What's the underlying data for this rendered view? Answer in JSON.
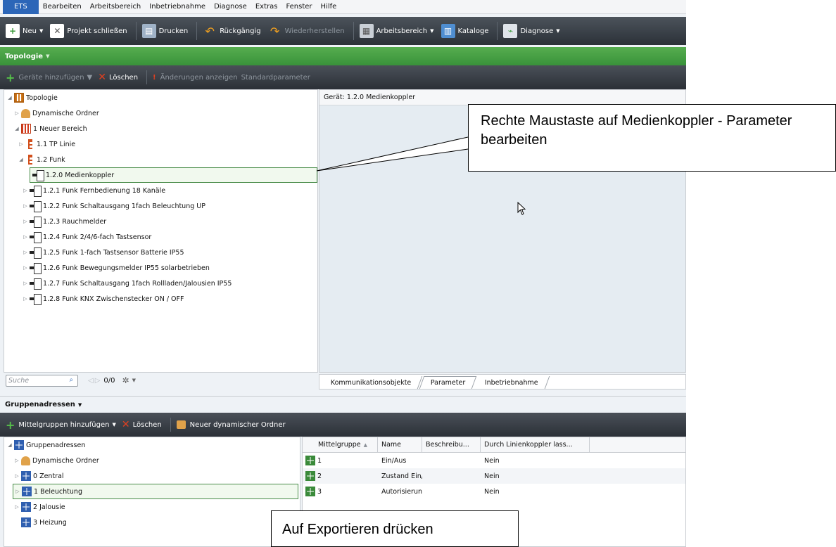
{
  "menubar": {
    "app": "ETS",
    "items": [
      "Bearbeiten",
      "Arbeitsbereich",
      "Inbetriebnahme",
      "Diagnose",
      "Extras",
      "Fenster",
      "Hilfe"
    ]
  },
  "toolbar": {
    "new": "Neu",
    "close_project": "Projekt schließen",
    "print": "Drucken",
    "undo": "Rückgängig",
    "redo": "Wiederherstellen",
    "workspace": "Arbeitsbereich",
    "catalogs": "Kataloge",
    "diagnostics": "Diagnose"
  },
  "topology_bar": {
    "title": "Topologie"
  },
  "topology_toolbar": {
    "add_devices": "Geräte hinzufügen",
    "delete": "Löschen",
    "show_changes": "Änderungen anzeigen",
    "default_params": "Standardparameter"
  },
  "topology_tree": {
    "root": "Topologie",
    "dynamic_folders": "Dynamische Ordner",
    "area": "1 Neuer Bereich",
    "line_tp": "1.1 TP Linie",
    "line_rf": "1.2 Funk",
    "devices": [
      "1.2.0  Medienkoppler",
      "1.2.1  Funk Fernbedienung 18 Kanäle",
      "1.2.2  Funk Schaltausgang 1fach Beleuchtung UP",
      "1.2.3  Rauchmelder",
      "1.2.4  Funk 2/4/6-fach Tastsensor",
      "1.2.5  Funk 1-fach Tastsensor Batterie IP55",
      "1.2.6  Funk Bewegungsmelder IP55 solarbetrieben",
      "1.2.7  Funk Schaltausgang 1fach Rollladen/Jalousien IP55",
      "1.2.8  Funk KNX Zwischenstecker ON / OFF"
    ]
  },
  "search": {
    "placeholder": "Suche",
    "counter": "0/0"
  },
  "detail": {
    "header": "Gerät: 1.2.0  Medienkoppler"
  },
  "tabs": [
    "Kommunikationsobjekte",
    "Parameter",
    "Inbetriebnahme"
  ],
  "group_bar": {
    "title": "Gruppenadressen"
  },
  "group_toolbar": {
    "add_middle": "Mittelgruppen hinzufügen",
    "delete": "Löschen",
    "new_dynamic_folder": "Neuer dynamischer Ordner"
  },
  "group_tree": {
    "root": "Gruppenadressen",
    "dynamic_folders": "Dynamische Ordner",
    "items": [
      "0 Zentral",
      "1 Beleuchtung",
      "2 Jalousie",
      "3 Heizung"
    ]
  },
  "group_table": {
    "headers": [
      "Mittelgruppe",
      "Name",
      "Beschreibu...",
      "Durch Linienkoppler lass..."
    ],
    "rows": [
      {
        "id": "1",
        "name": "Ein/Aus",
        "desc": "",
        "pass": "Nein"
      },
      {
        "id": "2",
        "name": "Zustand Ein/",
        "desc": "",
        "pass": "Nein"
      },
      {
        "id": "3",
        "name": "Autorisierun",
        "desc": "",
        "pass": "Nein"
      }
    ]
  },
  "callouts": {
    "top": "Rechte Maustaste auf Medienkoppler - Parameter bearbeiten",
    "bottom": "Auf Exportieren drücken"
  },
  "colors": {
    "accent_green": "#3a9a3a",
    "toolbar_dark": "#2b3138",
    "ets_blue": "#2c66b8"
  }
}
